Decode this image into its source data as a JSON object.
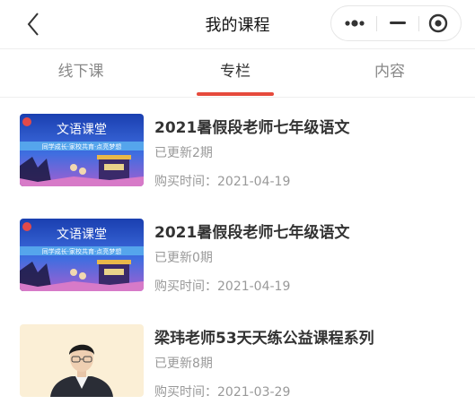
{
  "nav": {
    "title": "我的课程",
    "back_icon": "chevron-left-icon",
    "capsule_icons": [
      "more-dots-icon",
      "minimize-icon",
      "close-target-icon"
    ]
  },
  "tabs": [
    {
      "label": "线下课",
      "active": false
    },
    {
      "label": "专栏",
      "active": true
    },
    {
      "label": "内容",
      "active": false
    }
  ],
  "accent_color": "#e64a3c",
  "courses": [
    {
      "title": "2021暑假段老师七年级语文",
      "updated": "已更新2期",
      "date_label": "购买时间：",
      "date": "2021-04-19",
      "thumb": {
        "heading": "文语课堂",
        "banner": "同学成长·家校共育·点亮梦想"
      }
    },
    {
      "title": "2021暑假段老师七年级语文",
      "updated": "已更新0期",
      "date_label": "购买时间：",
      "date": "2021-04-19",
      "thumb": {
        "heading": "文语课堂",
        "banner": "同学成长·家校共育·点亮梦想"
      }
    },
    {
      "title": "梁玮老师53天天练公益课程系列",
      "updated": "已更新8期",
      "date_label": "购买时间：",
      "date": "2021-03-29",
      "thumb": {
        "heading": "",
        "banner": ""
      }
    }
  ]
}
